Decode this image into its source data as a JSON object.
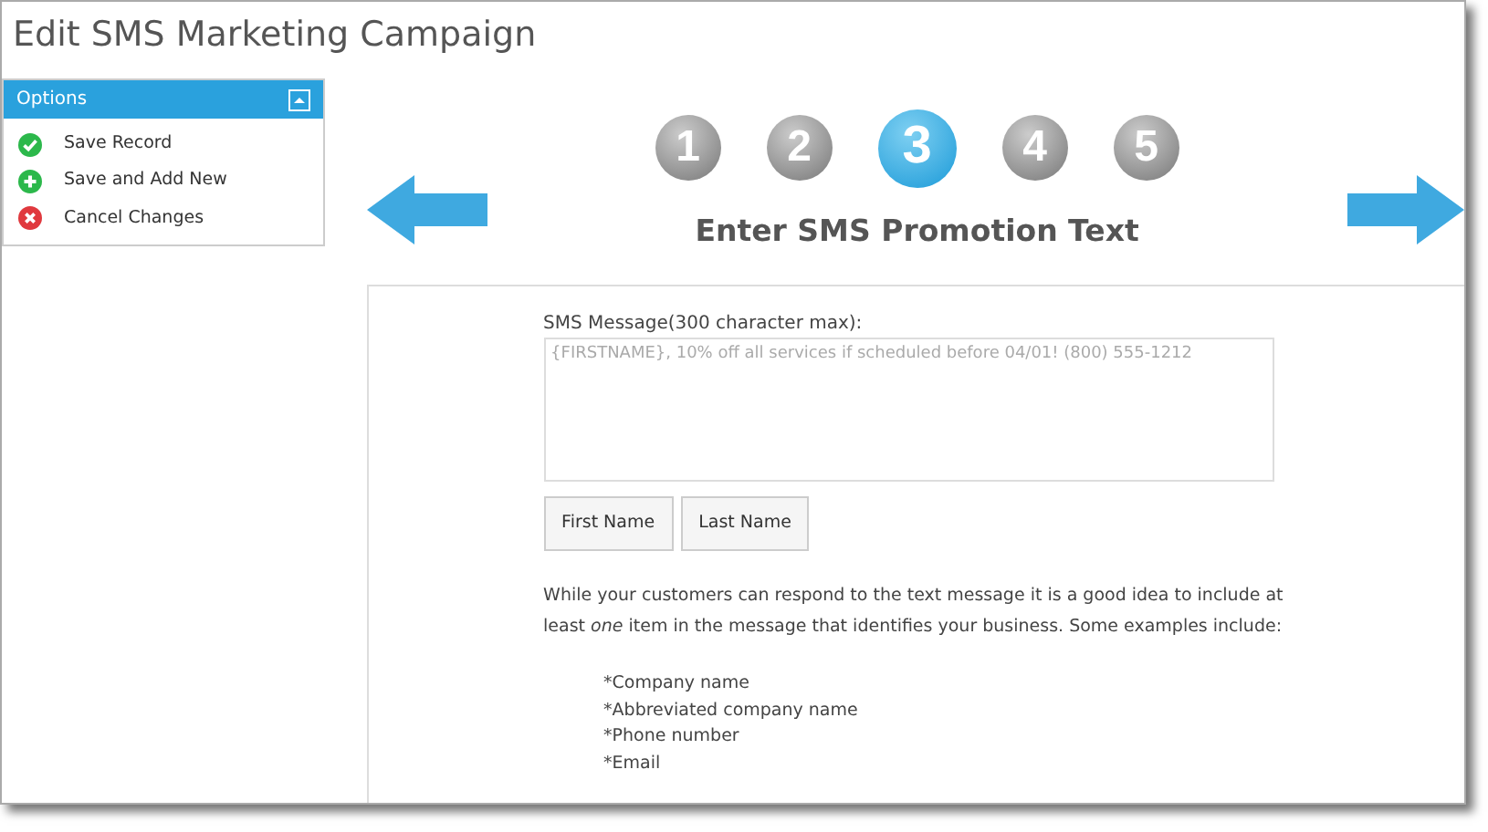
{
  "window": {
    "title": "Edit SMS Marketing Campaign"
  },
  "options_panel": {
    "title": "Options",
    "items": [
      {
        "kind": "check",
        "label": "Save Record"
      },
      {
        "kind": "plus",
        "label": "Save and Add New"
      },
      {
        "kind": "cross",
        "label": "Cancel Changes"
      }
    ]
  },
  "steps": [
    {
      "label": "1",
      "selected": false
    },
    {
      "label": "2",
      "selected": false
    },
    {
      "label": "3",
      "selected": true
    },
    {
      "label": "4",
      "selected": false
    },
    {
      "label": "5",
      "selected": false
    }
  ],
  "step_title": "Enter SMS Promotion Text",
  "message": {
    "label": "SMS Message(300 character max):",
    "placeholder": "{FIRSTNAME}, 10% off all services if scheduled before 04/01! (800) 555-1212"
  },
  "insert_buttons": [
    "First Name",
    "Last Name"
  ],
  "hint": "While your customers can respond to the text message it is a good idea to include at least *one* item in the message that identifies your business. Some examples include:",
  "examples": [
    "*Company name",
    "*Abbreviated company name",
    "*Phone number",
    "*Email"
  ]
}
